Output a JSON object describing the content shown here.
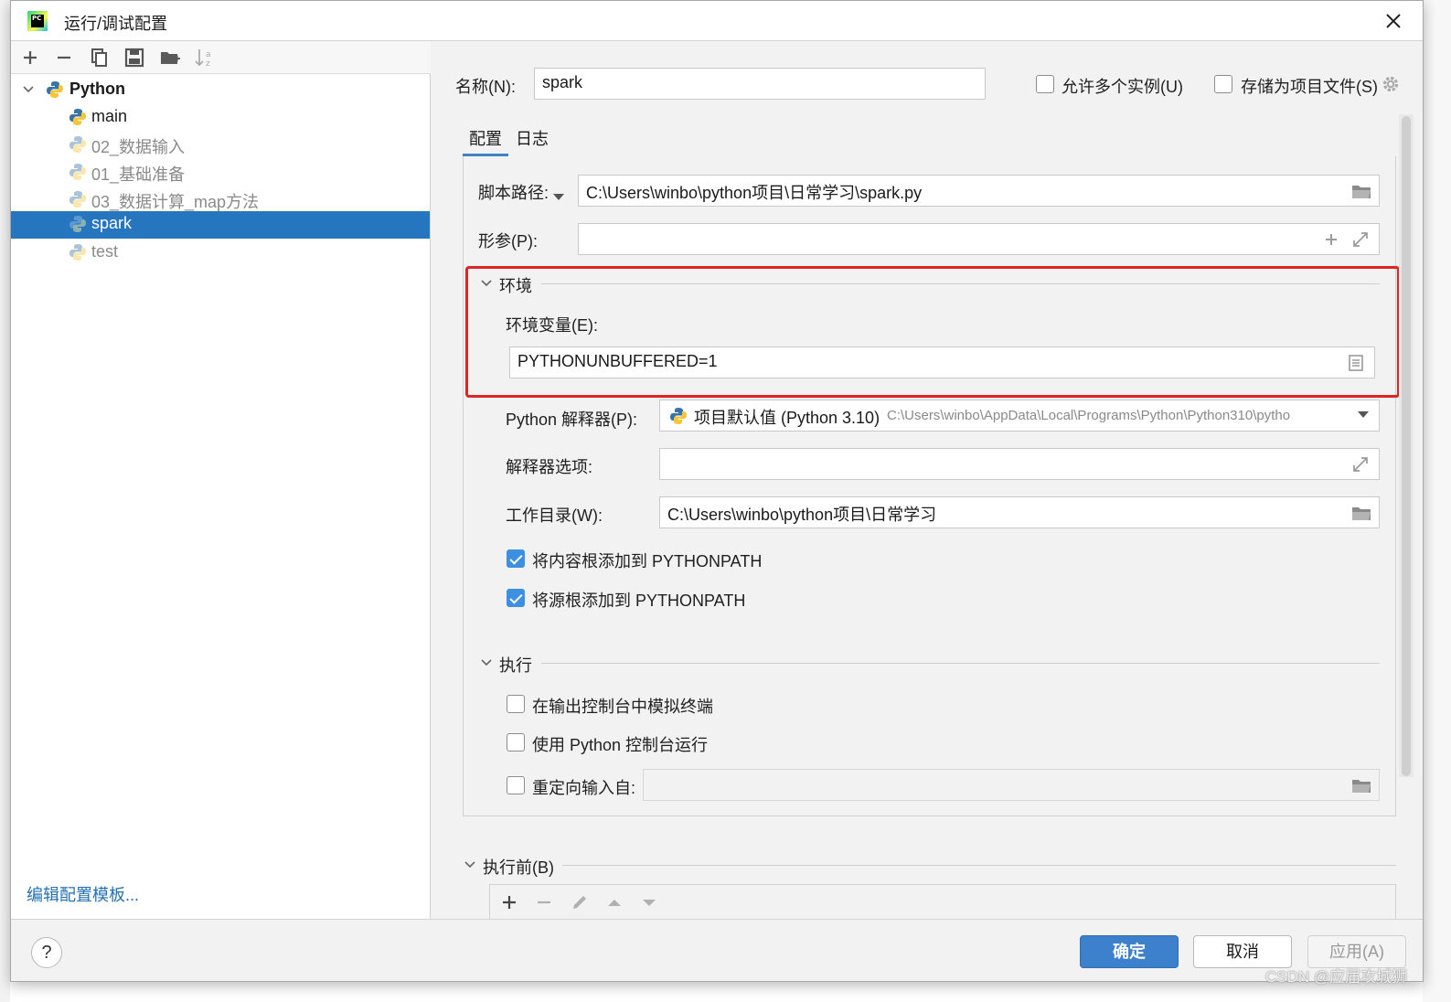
{
  "window": {
    "title": "运行/调试配置",
    "app_logo_text": "PC"
  },
  "left": {
    "toolbar": [
      "add-icon",
      "remove-icon",
      "copy-icon",
      "save-icon",
      "new-folder-icon",
      "sort-icon"
    ],
    "tree": {
      "root": "Python",
      "items": [
        {
          "label": "main",
          "temporary": false
        },
        {
          "label": "02_数据输入",
          "temporary": true
        },
        {
          "label": "01_基础准备",
          "temporary": true
        },
        {
          "label": "03_数据计算_map方法",
          "temporary": true
        },
        {
          "label": "spark",
          "temporary": true,
          "selected": true
        },
        {
          "label": "test",
          "temporary": true
        }
      ]
    },
    "edit_templates_link": "编辑配置模板..."
  },
  "right": {
    "name_label": "名称(N):",
    "name_value": "spark",
    "allow_parallel_label": "允许多个实例(U)",
    "allow_parallel_checked": false,
    "store_as_file_label": "存储为项目文件(S)",
    "store_as_file_checked": false,
    "tabs": [
      "配置",
      "日志"
    ],
    "active_tab": "配置",
    "script_path_label": "脚本路径:",
    "script_path_value": "C:\\Users\\winbo\\python项目\\日常学习\\spark.py",
    "params_label": "形参(P):",
    "params_value": "",
    "env_section_title": "环境",
    "env_vars_label": "环境变量(E):",
    "env_vars_value": "PYTHONUNBUFFERED=1",
    "interpreter_label": "Python 解释器(P):",
    "interpreter_name": "项目默认值 (Python 3.10)",
    "interpreter_path": "C:\\Users\\winbo\\AppData\\Local\\Programs\\Python\\Python310\\pytho",
    "interp_options_label": "解释器选项:",
    "interp_options_value": "",
    "workdir_label": "工作目录(W):",
    "workdir_value": "C:\\Users\\winbo\\python项目\\日常学习",
    "add_content_roots_label": "将内容根添加到 PYTHONPATH",
    "add_content_roots_checked": true,
    "add_source_roots_label": "将源根添加到 PYTHONPATH",
    "add_source_roots_checked": true,
    "exec_section_title": "执行",
    "emulate_terminal_label": "在输出控制台中模拟终端",
    "emulate_terminal_checked": false,
    "run_with_console_label": "使用 Python 控制台运行",
    "run_with_console_checked": false,
    "redirect_input_label": "重定向输入自:",
    "redirect_input_checked": false,
    "redirect_input_value": "",
    "before_launch_title": "执行前(B)"
  },
  "buttons": {
    "help": "?",
    "ok": "确定",
    "cancel": "取消",
    "apply": "应用(A)"
  },
  "watermark": "CSDN @应届攻城狮",
  "colors": {
    "selection": "#2675bf",
    "primary_button": "#3d80cc",
    "highlight_box": "#e02424",
    "link": "#2470b3"
  }
}
